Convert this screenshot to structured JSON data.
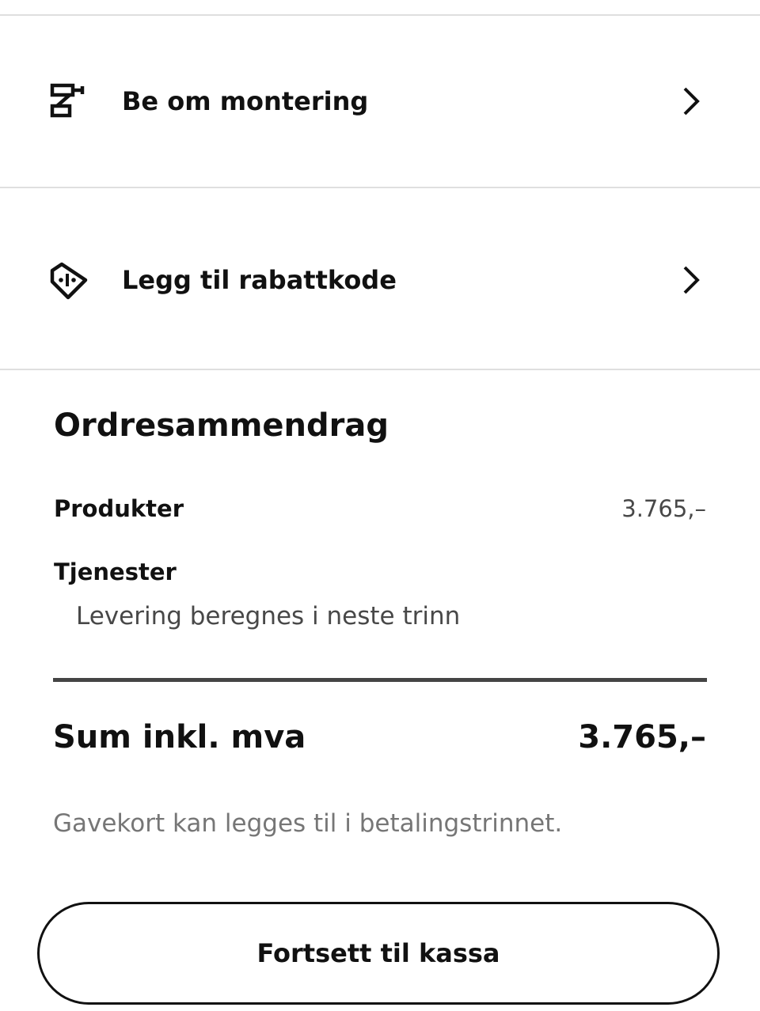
{
  "options": [
    {
      "icon": "assembly-drill-icon",
      "label": "Be om montering",
      "chevron": "chevron-right-icon"
    },
    {
      "icon": "discount-tag-icon",
      "label": "Legg til rabattkode",
      "chevron": "chevron-right-icon"
    }
  ],
  "summary": {
    "heading": "Ordresammendrag",
    "products_label": "Produkter",
    "products_value": "3.765,–",
    "services_label": "Tjenester",
    "services_note": "Levering beregnes i neste trinn",
    "total_label": "Sum inkl. mva",
    "total_value": "3.765,–",
    "gift_card_note": "Gavekort kan legges til i betalingstrinnet."
  },
  "checkout_button_label": "Fortsett til kassa"
}
